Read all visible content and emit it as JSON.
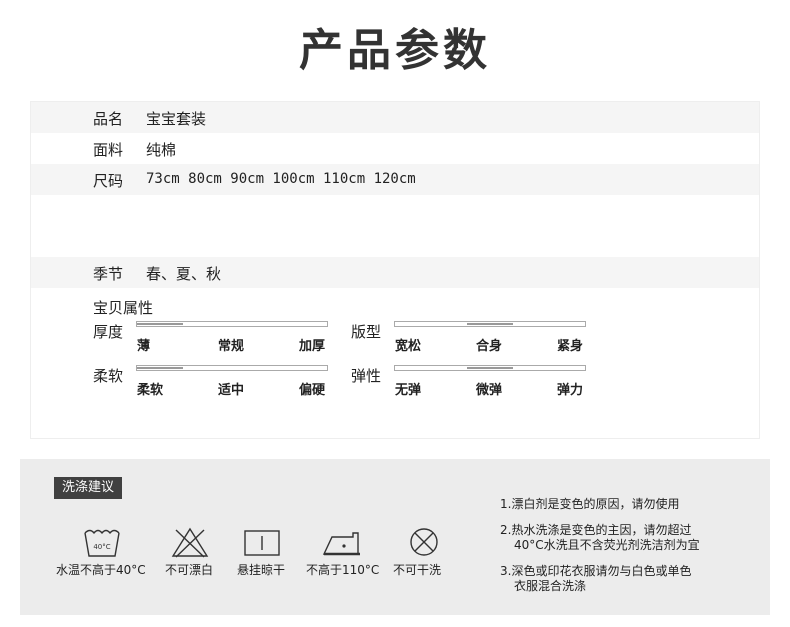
{
  "title": "产品参数",
  "params": {
    "name": {
      "label": "品名",
      "value": "宝宝套装"
    },
    "fabric": {
      "label": "面料",
      "value": "纯棉"
    },
    "size": {
      "label": "尺码",
      "value": "73cm 80cm 90cm 100cm 110cm 120cm"
    },
    "season": {
      "label": "季节",
      "value": "春、夏、秋"
    }
  },
  "attributes": {
    "title": "宝贝属性",
    "thickness": {
      "label": "厚度",
      "options": [
        "薄",
        "常规",
        "加厚"
      ],
      "level": 0.0
    },
    "fit": {
      "label": "版型",
      "options": [
        "宽松",
        "合身",
        "紧身"
      ],
      "level": 0.5
    },
    "softness": {
      "label": "柔软",
      "options": [
        "柔软",
        "适中",
        "偏硬"
      ],
      "level": 0.0
    },
    "elasticity": {
      "label": "弹性",
      "options": [
        "无弹",
        "微弹",
        "弹力"
      ],
      "level": 0.5
    }
  },
  "care": {
    "tag": "洗涤建议",
    "icons": [
      {
        "name": "wash-40-icon",
        "label": "水温不高于40°C",
        "text": "40°C"
      },
      {
        "name": "no-bleach-icon",
        "label": "不可漂白"
      },
      {
        "name": "line-dry-icon",
        "label": "悬挂晾干"
      },
      {
        "name": "iron-110-icon",
        "label": "不高于110°C"
      },
      {
        "name": "no-dryclean-icon",
        "label": "不可干洗"
      }
    ],
    "notes": [
      {
        "line1": "1.漂白剂是变色的原因，请勿使用"
      },
      {
        "line1": "2.热水洗涤是变色的主因，请勿超过",
        "line2": "40°C水洗且不含荧光剂洗洁剂为宜"
      },
      {
        "line1": "3.深色或印花衣服请勿与白色或单色",
        "line2": "衣服混合洗涤"
      }
    ]
  }
}
